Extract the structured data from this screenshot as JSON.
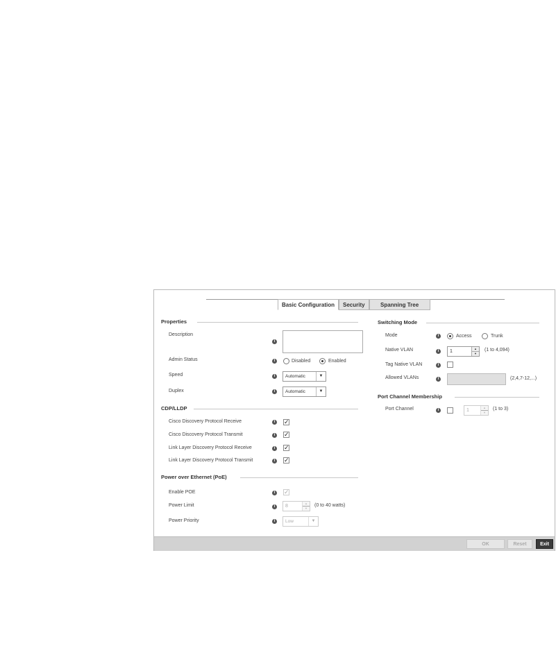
{
  "tabs": [
    "Basic Configuration",
    "Security",
    "Spanning Tree"
  ],
  "properties": {
    "title": "Properties",
    "description_label": "Description",
    "description_value": "",
    "admin_status_label": "Admin Status",
    "admin_status_options": [
      "Disabled",
      "Enabled"
    ],
    "admin_status_selected": "Enabled",
    "speed_label": "Speed",
    "speed_value": "Automatic",
    "duplex_label": "Duplex",
    "duplex_value": "Automatic"
  },
  "cdp_lldp": {
    "title": "CDP/LLDP",
    "items": [
      {
        "label": "Cisco Discovery Protocol Receive",
        "checked": true
      },
      {
        "label": "Cisco Discovery Protocol Transmit",
        "checked": true
      },
      {
        "label": "Link Layer Discovery Protocol Receive",
        "checked": true
      },
      {
        "label": "Link Layer Discovery Protocol Transmit",
        "checked": true
      }
    ]
  },
  "poe": {
    "title": "Power over Ethernet (PoE)",
    "enable_label": "Enable POE",
    "enable_checked": true,
    "power_limit_label": "Power Limit",
    "power_limit_value": "8",
    "power_limit_hint": "(0 to 40 watts)",
    "power_priority_label": "Power Priority",
    "power_priority_value": "Low"
  },
  "switching_mode": {
    "title": "Switching Mode",
    "mode_label": "Mode",
    "mode_options": [
      "Access",
      "Trunk"
    ],
    "mode_selected": "Access",
    "native_vlan_label": "Native VLAN",
    "native_vlan_value": "1",
    "native_vlan_hint": "(1 to 4,094)",
    "tag_native_vlan_label": "Tag Native VLAN",
    "tag_native_vlan_checked": false,
    "allowed_vlans_label": "Allowed VLANs",
    "allowed_vlans_value": "",
    "allowed_vlans_hint": "(2,4,7-12,...)"
  },
  "port_channel": {
    "title": "Port Channel Membership",
    "label": "Port Channel",
    "checked": false,
    "value": "1",
    "hint": "(1 to 3)"
  },
  "footer": {
    "ok": "OK",
    "reset": "Reset",
    "exit": "Exit"
  },
  "icons": {
    "info": "info-icon",
    "check": "check-icon",
    "arrow": "chevron-down-icon"
  }
}
